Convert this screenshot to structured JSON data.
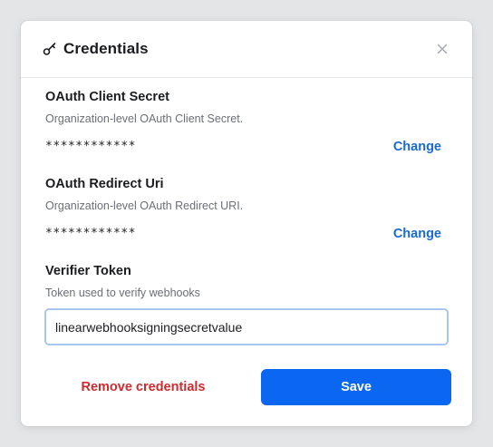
{
  "dialog": {
    "title": "Credentials",
    "colors": {
      "accent": "#0b66f2",
      "link": "#1a6ad6",
      "danger": "#cf2a2e"
    }
  },
  "fields": {
    "client_secret": {
      "title": "OAuth Client Secret",
      "description": "Organization-level OAuth Client Secret.",
      "masked_value": "************",
      "action_label": "Change"
    },
    "redirect_uri": {
      "title": "OAuth Redirect Uri",
      "description": "Organization-level OAuth Redirect URI.",
      "masked_value": "************",
      "action_label": "Change"
    },
    "verifier_token": {
      "title": "Verifier Token",
      "description": "Token used to verify webhooks",
      "value": "linearwebhooksigningsecretvalue"
    }
  },
  "footer": {
    "remove_label": "Remove credentials",
    "save_label": "Save"
  }
}
